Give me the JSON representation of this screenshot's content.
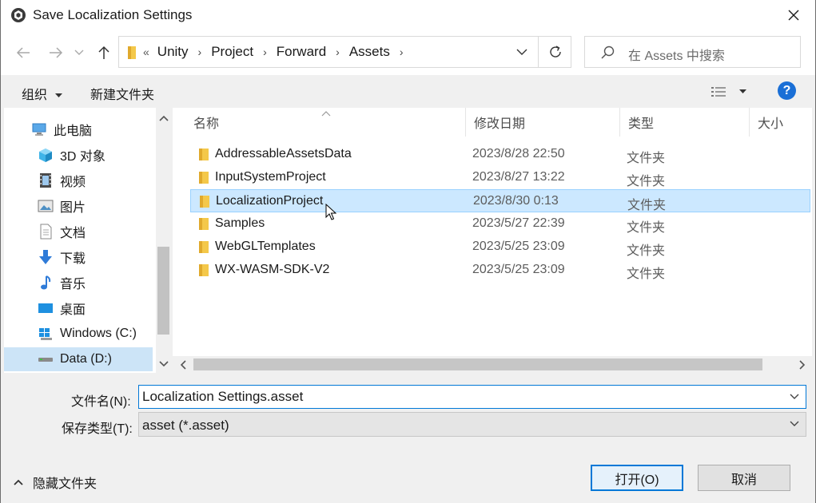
{
  "window": {
    "title": "Save Localization Settings"
  },
  "nav": {
    "crumb_lead": "«",
    "breadcrumbs": [
      "Unity",
      "Project",
      "Forward",
      "Assets"
    ],
    "search_placeholder": "在 Assets 中搜索"
  },
  "toolbar": {
    "organize": "组织",
    "new_folder": "新建文件夹"
  },
  "sidebar": {
    "items": [
      {
        "label": "此电脑",
        "icon": "computer-icon"
      },
      {
        "label": "3D 对象",
        "icon": "cube-icon"
      },
      {
        "label": "视频",
        "icon": "video-icon"
      },
      {
        "label": "图片",
        "icon": "picture-icon"
      },
      {
        "label": "文档",
        "icon": "document-icon"
      },
      {
        "label": "下载",
        "icon": "download-icon"
      },
      {
        "label": "音乐",
        "icon": "music-icon"
      },
      {
        "label": "桌面",
        "icon": "desktop-icon"
      },
      {
        "label": "Windows (C:)",
        "icon": "windows-drive-icon"
      },
      {
        "label": "Data (D:)",
        "icon": "drive-icon"
      }
    ],
    "selected_index": 9
  },
  "filelist": {
    "columns": [
      "名称",
      "修改日期",
      "类型",
      "大小"
    ],
    "rows": [
      {
        "name": "AddressableAssetsData",
        "date": "2023/8/28 22:50",
        "type": "文件夹"
      },
      {
        "name": "InputSystemProject",
        "date": "2023/8/27 13:22",
        "type": "文件夹"
      },
      {
        "name": "LocalizationProject",
        "date": "2023/8/30 0:13",
        "type": "文件夹"
      },
      {
        "name": "Samples",
        "date": "2023/5/27 22:39",
        "type": "文件夹"
      },
      {
        "name": "WebGLTemplates",
        "date": "2023/5/25 23:09",
        "type": "文件夹"
      },
      {
        "name": "WX-WASM-SDK-V2",
        "date": "2023/5/25 23:09",
        "type": "文件夹"
      }
    ],
    "selected_index": 2
  },
  "form": {
    "filename_label": "文件名(N):",
    "filename_value": "Localization Settings.asset",
    "filetype_label": "保存类型(T):",
    "filetype_value": "asset (*.asset)"
  },
  "footer": {
    "hide_folders": "隐藏文件夹",
    "open_button": "打开(O)",
    "cancel_button": "取消"
  },
  "colors": {
    "accent": "#0078d7",
    "selection": "#cce8ff",
    "folder": "#f4c84a",
    "help": "#1a6fd6"
  }
}
